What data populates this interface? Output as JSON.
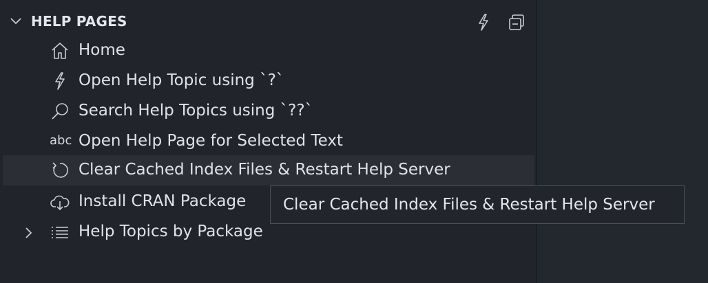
{
  "section": {
    "title": "HELP PAGES",
    "actions": [
      {
        "icon": "lightning-icon"
      },
      {
        "icon": "collapse-all-icon"
      }
    ]
  },
  "items": [
    {
      "label": "Home",
      "icon": "home-icon"
    },
    {
      "label": "Open Help Topic using `?`",
      "icon": "lightning-icon"
    },
    {
      "label": "Search Help Topics using `??`",
      "icon": "search-icon"
    },
    {
      "label": "Open Help Page for Selected Text",
      "icon": "abc-icon",
      "icon_text": "abc"
    },
    {
      "label": "Clear Cached Index Files & Restart Help Server",
      "icon": "refresh-icon",
      "hovered": true
    },
    {
      "label": "Install CRAN Package",
      "icon": "cloud-download-icon"
    },
    {
      "label": "Help Topics by Package",
      "icon": "list-icon",
      "expandable": true
    }
  ],
  "tooltip": {
    "text": "Clear Cached Index Files & Restart Help Server"
  },
  "colors": {
    "sidebar_bg": "#21252b",
    "editor_bg": "#23272e",
    "hover_bg": "#2b2e35",
    "text": "#dfe2e6"
  }
}
